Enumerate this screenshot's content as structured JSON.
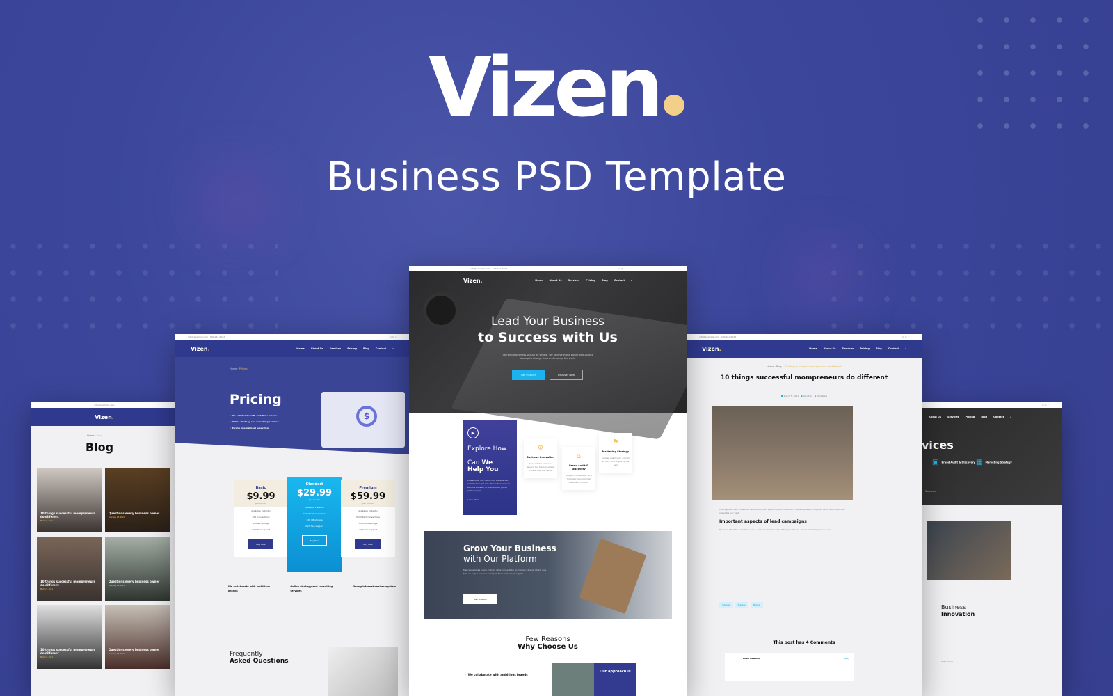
{
  "hero": {
    "brand": "Vizen",
    "subtitle": "Business PSD Template",
    "accent": "#f2d08a",
    "bg": "#3d4a9e"
  },
  "common": {
    "brand": "Vizen",
    "email": "info@example.com",
    "phone": "409-941-2023",
    "nav": [
      "Home",
      "About Us",
      "Services",
      "Pricing",
      "Blog",
      "Contact"
    ],
    "social": [
      "in",
      "◎",
      "✓"
    ]
  },
  "home": {
    "headline_1": "Lead Your Business",
    "headline_2": "to Success with Us",
    "intro": "Starting a business should be simple. We believe in the power of business startup to change lives and change the world",
    "btn_primary": "Get In Touch",
    "btn_secondary": "Discover Now",
    "explore": {
      "line1": "Explore How",
      "line2a": "Can ",
      "line2b": "We",
      "line3": "Help You",
      "text": "Praesent et dui, mollis non sodales vel, sollicitudin eget arcu. Fusce hendrerit ex et risus sodales, et ullamcorper purus pellentesque.",
      "link": "Learn More"
    },
    "services": [
      {
        "title": "Business Innovation",
        "text": "Consectetur sociosqu among the top consulting firms across the nation"
      },
      {
        "title": "Brand Audit & Discovery",
        "text": "Aliquam consectetur at a modestly nonummy ac facilisis ut rhoncus"
      },
      {
        "title": "Marketing Strategy",
        "text": "Integer quam velit, rutrum et nunc ut, congue varius sem"
      }
    ],
    "grow": {
      "title_bold": "Grow Your Business",
      "title_light": "with Our Platform",
      "text": "Maecenas ligula lorem, rutrum vitae consectetur ac, tempor id eros. Etiam quis felis eu neque pulvinar volutpat. Nam fermentum sagittis.",
      "button": "Get to Know"
    },
    "reasons": {
      "line1": "Few Reasons",
      "line2": "Why Choose Us"
    },
    "why_item": "We collaborate with ambitious brands",
    "approach": "Our approach is"
  },
  "pricing_page": {
    "breadcrumb": [
      "Home",
      "Pricing"
    ],
    "title": "Pricing",
    "bullets": [
      "We collaborate with ambitious brands",
      "Online strategy and consulting services",
      "Strong international ecosystem"
    ],
    "plans": [
      {
        "name": "Basic",
        "price": "$9.99",
        "period": "per month",
        "features": [
          "Available instantly",
          "300 transactions",
          "128 GB storage",
          "24/7 free support"
        ],
        "button": "Buy Now"
      },
      {
        "name": "Standart",
        "price": "$29.99",
        "period": "per month",
        "features": [
          "Available instantly",
          "Unlimited transactions",
          "128 GB storage",
          "24/7 free support"
        ],
        "button": "Buy Now",
        "featured": true
      },
      {
        "name": "Premium",
        "price": "$59.99",
        "period": "per month",
        "features": [
          "Available instantly",
          "Unlimited transactions",
          "Unlimited storage",
          "24/7 free support"
        ],
        "button": "Buy Now"
      }
    ],
    "features": [
      "We collaborate with ambitious brands",
      "Online strategy and consulting services",
      "Strong international ecosystem"
    ],
    "faq": {
      "line1": "Frequently",
      "line2": "Asked Questions"
    }
  },
  "blog_page": {
    "breadcrumb": [
      "Home",
      "Blog"
    ],
    "title": "Blog",
    "posts": [
      {
        "title": "10 things successful mompreneurs do different",
        "date": "March 5, 2021"
      },
      {
        "title": "Questions every business owner",
        "date": "February 18, 2021"
      },
      {
        "title": "10 things successful mompreneurs do different",
        "date": "March 5, 2021"
      },
      {
        "title": "Questions every business owner",
        "date": "February 18, 2021"
      },
      {
        "title": "10 things successful mompreneurs do different",
        "date": "March 5, 2021"
      },
      {
        "title": "Questions every business owner",
        "date": "February 18, 2021"
      }
    ]
  },
  "post_page": {
    "breadcrumb": [
      "Home",
      "Blog",
      "10 things successful mompreneurs do different"
    ],
    "title": "10 things successful mompreneurs do different",
    "meta": [
      "March 5, 2021",
      "John Doe",
      "Marketing"
    ],
    "subheading": "Important aspects of lead campaigns",
    "tags": [
      "Interest",
      "Startup",
      "Mobile"
    ],
    "comments_title": "This post has 4 Comments",
    "comment": {
      "author": "Louis Hawkins",
      "reply": "Reply"
    }
  },
  "services_page": {
    "title": "vices",
    "items": [
      "Brand Audit & Discovery",
      "Marketing Strategy"
    ],
    "breadcrumb": "Services",
    "section_light": "Business",
    "section_bold": "Innovation",
    "link": "Learn More"
  }
}
